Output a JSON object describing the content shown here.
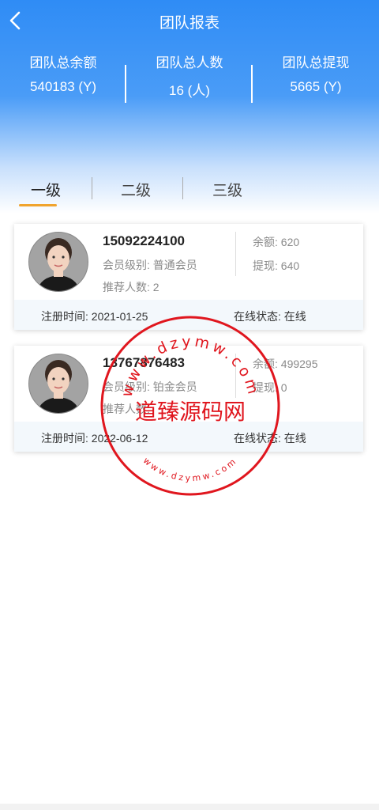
{
  "header": {
    "title": "团队报表",
    "stats": [
      {
        "label": "团队总余额",
        "value": "540183 (Y)"
      },
      {
        "label": "团队总人数",
        "value": "16 (人)"
      },
      {
        "label": "团队总提现",
        "value": "5665 (Y)"
      }
    ]
  },
  "tabs": [
    {
      "label": "一级",
      "active": true
    },
    {
      "label": "二级",
      "active": false
    },
    {
      "label": "三级",
      "active": false
    }
  ],
  "members": [
    {
      "phone": "15092224100",
      "level_label": "会员级别:",
      "level": "普通会员",
      "referrals_label": "推荐人数:",
      "referrals": "2",
      "balance_label": "余额:",
      "balance": "620",
      "withdraw_label": "提现:",
      "withdraw": "640",
      "reg_label": "注册时间:",
      "reg_date": "2021-01-25",
      "status_label": "在线状态:",
      "status": "在线"
    },
    {
      "phone": "13767876483",
      "level_label": "会员级别:",
      "level": "铂金会员",
      "referrals_label": "推荐人数:",
      "referrals": "",
      "balance_label": "余额:",
      "balance": "499295",
      "withdraw_label": "提现:",
      "withdraw": "0",
      "reg_label": "注册时间:",
      "reg_date": "2022-06-12",
      "status_label": "在线状态:",
      "status": "在线"
    }
  ],
  "watermark": {
    "main": "道臻源码网",
    "ring_top": "www.dzymw.com",
    "ring_bottom": "www.dzymw.com",
    "color": "#e0161e"
  },
  "icons": {
    "back": "chevron-left-icon"
  },
  "colors": {
    "header_top": "#2f8cf5",
    "tab_underline": "#f0a42e"
  }
}
